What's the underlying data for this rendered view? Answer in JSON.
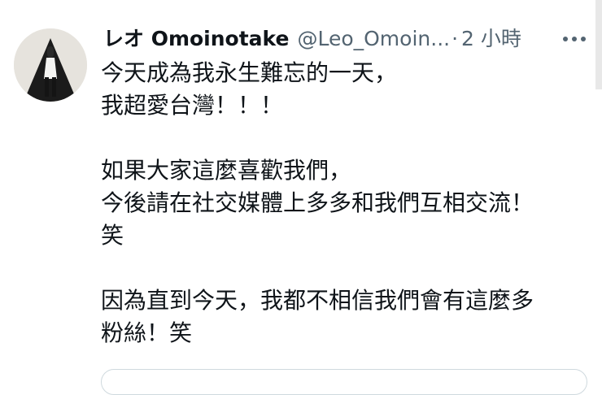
{
  "tweet": {
    "display_name": "レオ Omoinotake",
    "handle": "@Leo_Omoin...",
    "separator": "·",
    "time": "2 小時",
    "more_icon": "more-horizontal-icon",
    "body": {
      "line1": "今天成為我永生難忘的一天，",
      "line2": "我超愛台灣！！！",
      "line3": "如果大家這麼喜歡我們，",
      "line4": "今後請在社交媒體上多多和我們互相交流！",
      "line5": "笑",
      "line6": "因為直到今天，我都不相信我們會有這麼多",
      "line7": "粉絲！笑"
    }
  },
  "colors": {
    "text_primary": "#0f1419",
    "text_secondary": "#536471",
    "border": "#cfd9de"
  }
}
